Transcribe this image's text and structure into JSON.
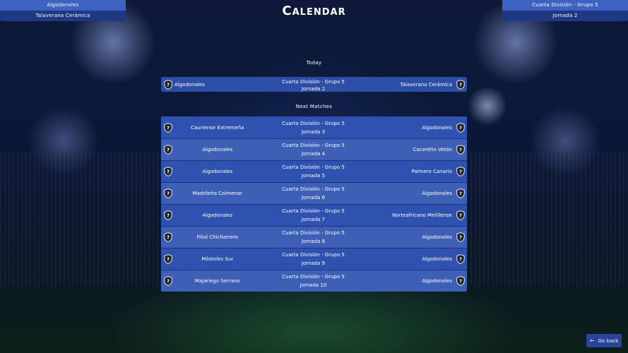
{
  "top_left": {
    "line1": "Algodonales",
    "line2": "Talaverana Cerámica"
  },
  "top_right": {
    "line1": "Cuarta División - Grupo 5",
    "line2": "Jornada 2"
  },
  "page_title": "Calendar",
  "today_label": "Today",
  "today_match": {
    "home": "Algodonales",
    "competition": "Cuarta División - Grupo 5",
    "round": "Jornada 2",
    "away": "Talaverana Cerámica"
  },
  "next_label": "Next Matches",
  "matches": [
    {
      "home": "Cauriense Extremeña",
      "competition": "Cuarta División - Grupo 5",
      "round": "Jornada 3",
      "away": "Algodonales"
    },
    {
      "home": "Algodonales",
      "competition": "Cuarta División - Grupo 5",
      "round": "Jornada 4",
      "away": "Caceréño Vetón"
    },
    {
      "home": "Algodonales",
      "competition": "Cuarta División - Grupo 5",
      "round": "Jornada 5",
      "away": "Palmero Canario"
    },
    {
      "home": "Madrileña Colmenar",
      "competition": "Cuarta División - Grupo 5",
      "round": "Jornada 6",
      "away": "Algodonales"
    },
    {
      "home": "Algodonales",
      "competition": "Cuarta División - Grupo 5",
      "round": "Jornada 7",
      "away": "Norteafricano Melillense"
    },
    {
      "home": "Filial Chicharrero",
      "competition": "Cuarta División - Grupo 5",
      "round": "Jornada 8",
      "away": "Algodonales"
    },
    {
      "home": "Móstoles Sur",
      "competition": "Cuarta División - Grupo 5",
      "round": "Jornada 9",
      "away": "Algodonales"
    },
    {
      "home": "Majariego Serrano",
      "competition": "Cuarta División - Grupo 5",
      "round": "Jornada 10",
      "away": "Algodonales"
    }
  ],
  "go_back": {
    "icon": "arrow-left-icon",
    "label": "Go back"
  },
  "colors": {
    "row": "#2f52b0",
    "row_alt": "#3e5fb6",
    "header_button": "#27449a"
  }
}
